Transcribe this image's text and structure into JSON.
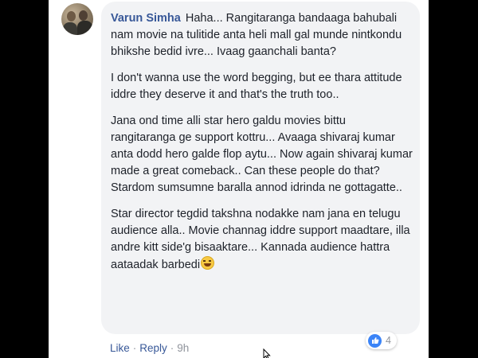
{
  "comment": {
    "author": "Varun Simha",
    "paragraphs": [
      "Haha... Rangitaranga bandaaga bahubali nam movie na tulitide anta heli mall gal munde nintkondu bhikshe bedid ivre... Ivaag gaanchali banta?",
      "I don't wanna use the word begging, but ee thara attitude iddre they deserve it and that's the truth too..",
      "Jana ond time alli star hero galdu movies bittu rangitaranga ge support kottru... Avaaga shivaraj kumar anta dodd hero galde flop aytu... Now again shivaraj kumar made a great comeback.. Can these people do that? Stardom sumsumne baralla annod idrinda ne gottagatte..",
      "Star director tegdid takshna nodakke nam jana en telugu audience alla.. Movie channag iddre support maadtare, illa andre kitt side'g bisaaktare... Kannada audience hattra aataadak barbedi"
    ],
    "emoji_icon": "laughing-tears-emoji"
  },
  "actions": {
    "like": "Like",
    "separator": "·",
    "reply": "Reply",
    "time": "9h"
  },
  "reactions": {
    "icon": "like-thumb-icon",
    "count": "4"
  },
  "colors": {
    "author": "#385898",
    "bubble": "#f2f3f5",
    "like_badge": "#3b84f7",
    "letterbox": "#000000"
  }
}
